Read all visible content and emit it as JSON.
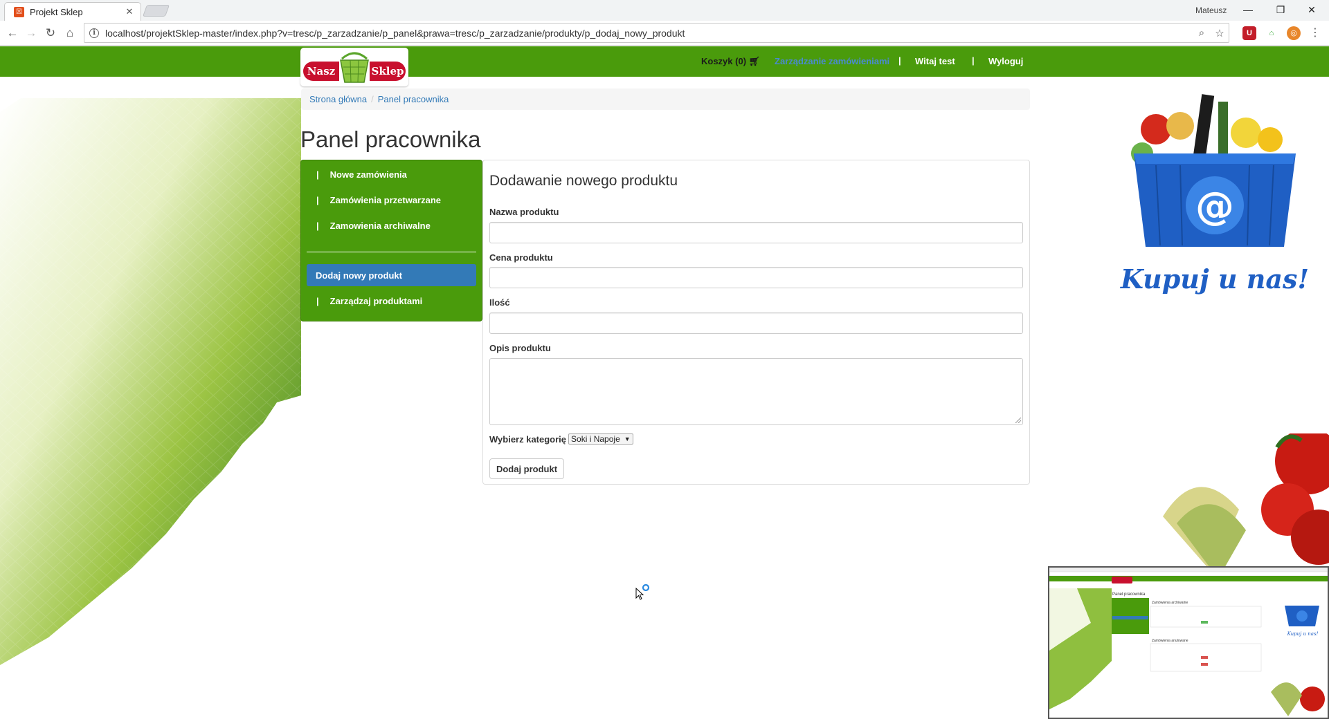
{
  "browser": {
    "tab_title": "Projekt Sklep",
    "tab_close": "✕",
    "profile_name": "Mateusz",
    "url": "localhost/projektSklep-master/index.php?v=tresc/p_zarzadzanie/p_panel&prawa=tresc/p_zarzadzanie/produkty/p_dodaj_nowy_produkt",
    "win_min": "—",
    "win_restore": "❐",
    "win_close": "✕"
  },
  "logo": {
    "left": "Nasz",
    "right": "Sklep"
  },
  "navbar": {
    "cart": "Koszyk (0)",
    "manage_orders": "Zarządzanie zamówieniami",
    "separator": "|",
    "welcome": "Witaj test",
    "logout": "Wyloguj"
  },
  "breadcrumb": {
    "home": "Strona główna",
    "separator": "/",
    "current": "Panel pracownika"
  },
  "page_title": "Panel pracownika",
  "sidebar": {
    "bar": "|",
    "items": [
      {
        "label": "Nowe zamówienia"
      },
      {
        "label": "Zamówienia przetwarzane"
      },
      {
        "label": "Zamowienia archiwalne"
      },
      {
        "label": "Dodaj nowy produkt"
      },
      {
        "label": "Zarządzaj produktami"
      }
    ]
  },
  "form": {
    "title": "Dodawanie nowego produktu",
    "name_label": "Nazwa produktu",
    "name_value": "",
    "price_label": "Cena produktu",
    "price_value": "",
    "qty_label": "Ilość",
    "qty_value": "",
    "desc_label": "Opis produktu",
    "category_label": "Wybierz kategorię",
    "category_selected": "Soki i Napoje",
    "submit": "Dodaj produkt"
  },
  "banner": {
    "slogan": "Kupuj u nas!"
  },
  "thumbnail": {
    "title": "Panel pracownika",
    "section1": "Zamówienia archiwalne",
    "section2": "Zamówienia anulowane",
    "slogan": "Kupuj u nas!"
  },
  "colors": {
    "navbar_green": "#4a9b0c",
    "active_blue": "#337ab7",
    "logo_red": "#c8102e"
  }
}
